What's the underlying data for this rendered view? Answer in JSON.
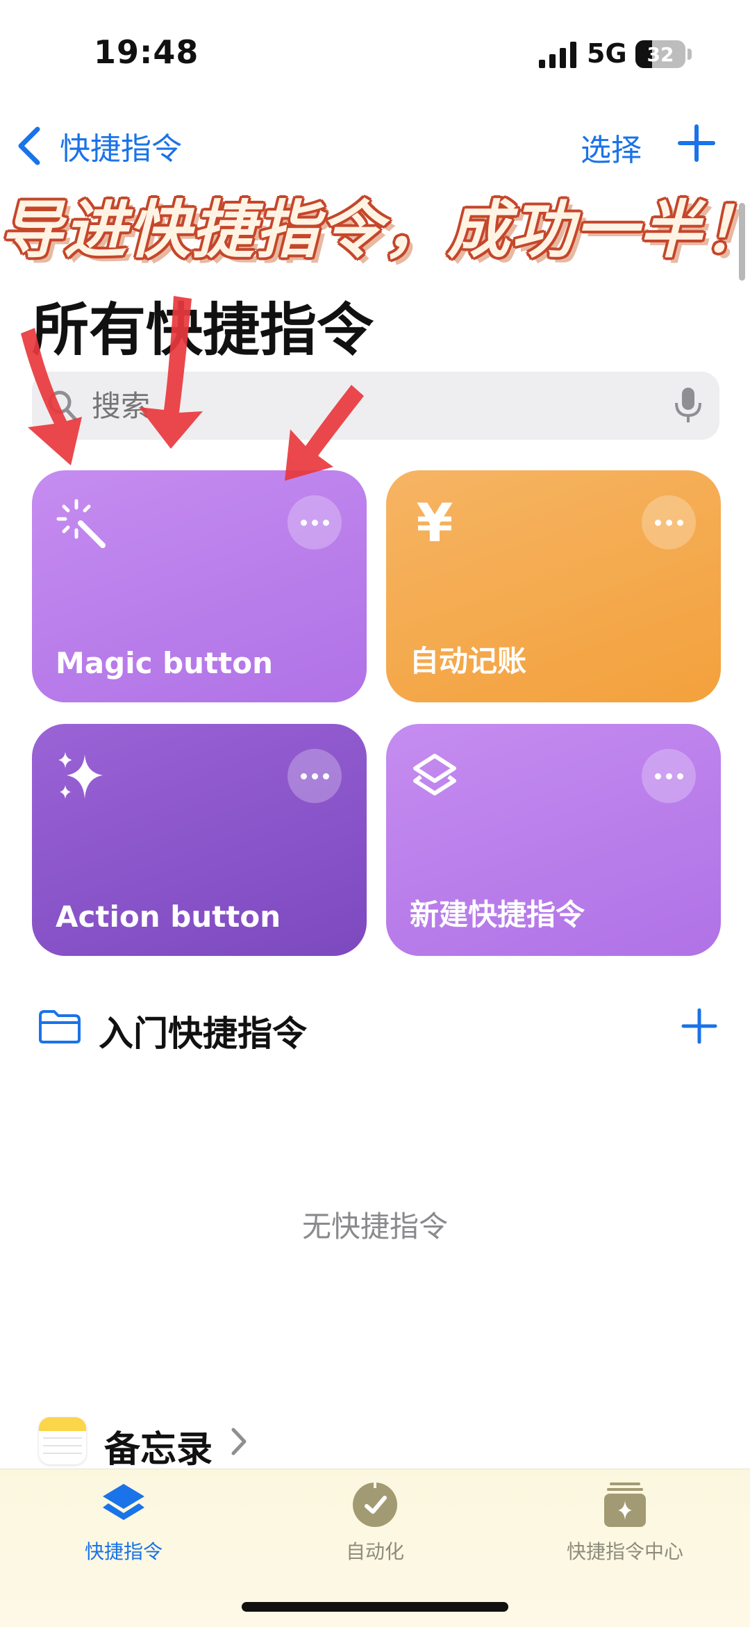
{
  "status_bar": {
    "time": "19:48",
    "network": "5G",
    "battery": "32"
  },
  "nav": {
    "back_label": "快捷指令",
    "select_label": "选择"
  },
  "overlay": {
    "banner": "导进快捷指令，成功一半！"
  },
  "page": {
    "title": "所有快捷指令"
  },
  "search": {
    "placeholder": "搜索"
  },
  "shortcuts": [
    {
      "label": "Magic button",
      "icon": "magic-wand-icon",
      "color": "#b87bea"
    },
    {
      "label": "自动记账",
      "icon": "yen-icon",
      "color": "#f5aa4c"
    },
    {
      "label": "Action button",
      "icon": "sparkles-icon",
      "color": "#8d56cb"
    },
    {
      "label": "新建快捷指令",
      "icon": "layers-icon",
      "color": "#b87bea"
    }
  ],
  "folder": {
    "title": "入门快捷指令",
    "empty_text": "无快捷指令"
  },
  "notes_section": {
    "title": "备忘录"
  },
  "tabs": [
    {
      "label": "快捷指令",
      "active": true
    },
    {
      "label": "自动化",
      "active": false
    },
    {
      "label": "快捷指令中心",
      "active": false
    }
  ],
  "accent_color": "#1a73e8"
}
